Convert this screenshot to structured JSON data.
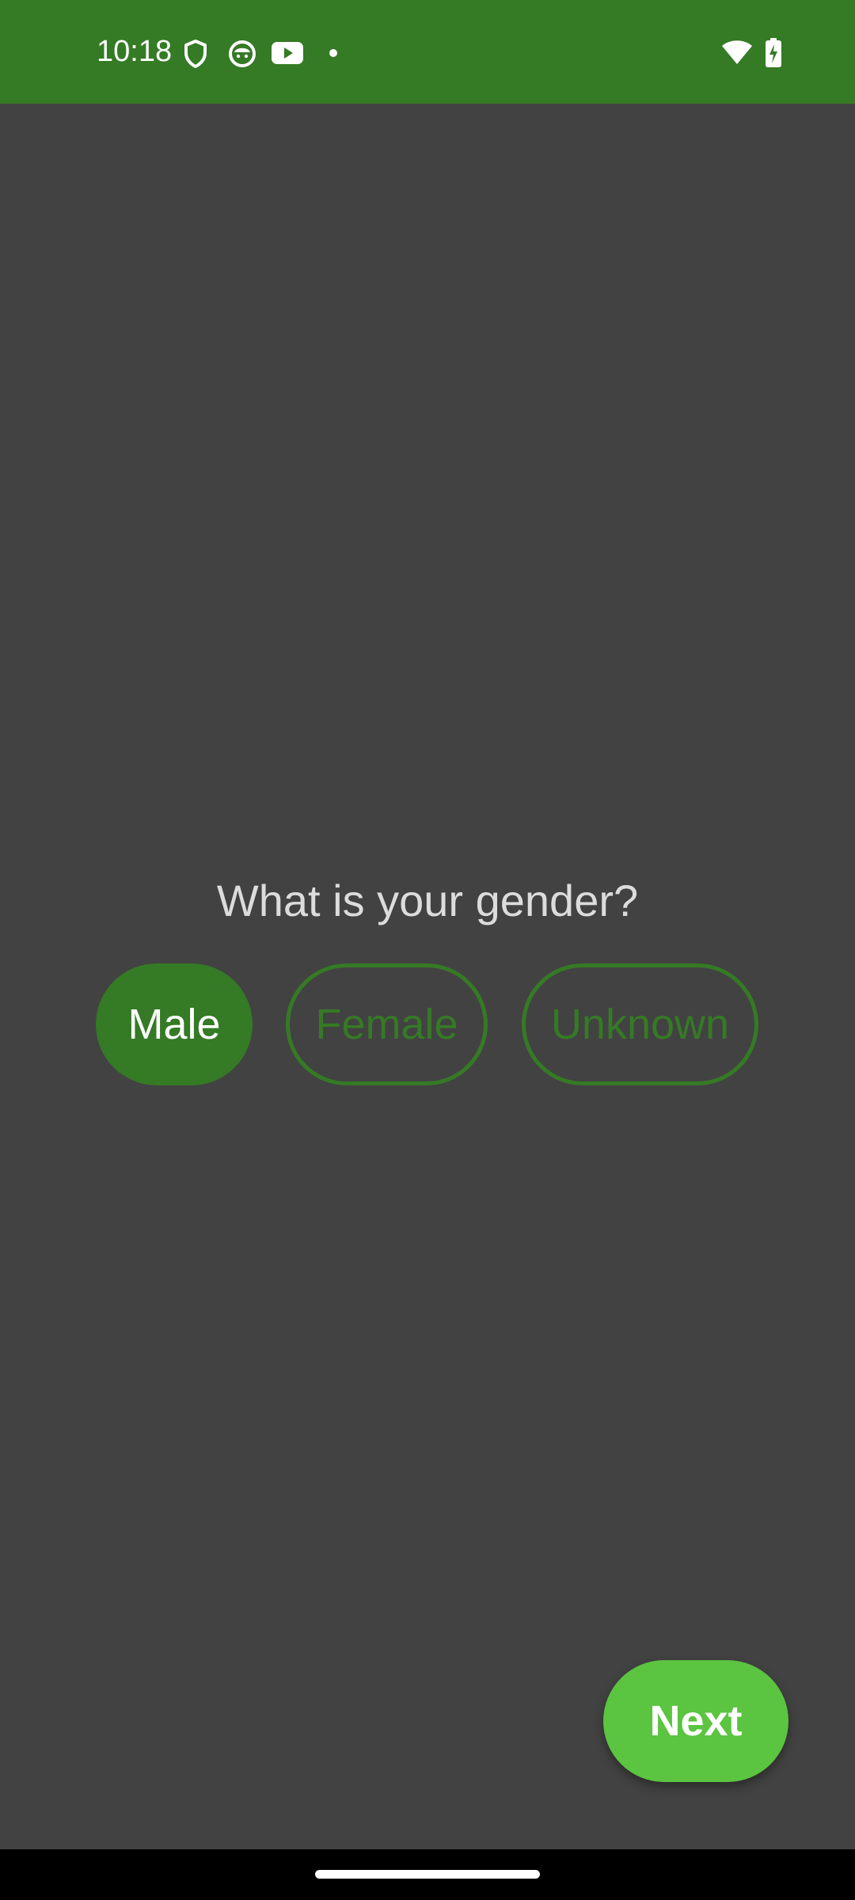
{
  "status_bar": {
    "time": "10:18",
    "icons": [
      "shield-icon",
      "cat-face-icon",
      "youtube-icon",
      "dot-icon",
      "wifi-icon",
      "battery-charging-icon"
    ],
    "background": "#357a25"
  },
  "survey": {
    "question": "What is your gender?",
    "options": [
      {
        "label": "Male",
        "selected": true
      },
      {
        "label": "Female",
        "selected": false
      },
      {
        "label": "Unknown",
        "selected": false
      }
    ],
    "next_label": "Next"
  },
  "colors": {
    "accent": "#357a25",
    "next_button": "#5bc440",
    "background": "#424242",
    "question_text": "#dcdcdc"
  }
}
